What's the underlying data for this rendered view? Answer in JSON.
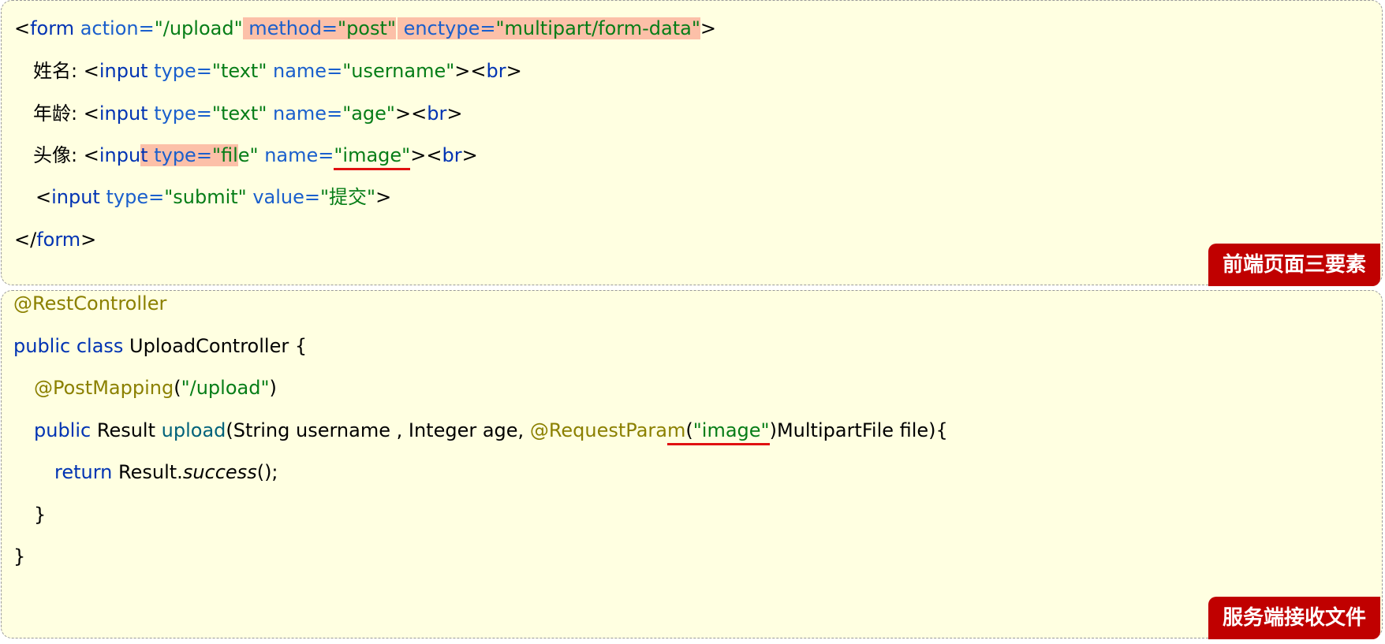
{
  "front": {
    "form_open": {
      "lt": "<",
      "tag": "form",
      "action_attr": " action=",
      "action_val": "\"/upload\"",
      "method_attr": " method=",
      "method_val": "\"post\"",
      "enctype_attr": " enctype=",
      "enctype_val": "\"multipart/form-data\"",
      "gt": ">"
    },
    "name_row": {
      "label": "姓名: ",
      "lt": "<",
      "tag": "input",
      "type_attr": " type=",
      "type_val": "\"text\"",
      "name_attr": " name=",
      "name_val": "\"username\"",
      "gt": ">",
      "br_lt": "<",
      "br": "br",
      "br_gt": ">"
    },
    "age_row": {
      "label": "年龄: ",
      "lt": "<",
      "tag": "input",
      "type_attr": " type=",
      "type_val": "\"text\"",
      "name_attr": " name=",
      "name_val": "\"age\"",
      "gt": ">",
      "br_lt": "<",
      "br": "br",
      "br_gt": ">"
    },
    "image_row": {
      "label": "头像: ",
      "lt": "<",
      "tag_a": "inpu",
      "tag_b": "t",
      "type_attr": " type=",
      "type_val_a": "\"fil",
      "type_val_b": "e\"",
      "name_attr": " name=",
      "name_val": "\"image\"",
      "gt": ">",
      "br_lt": "<",
      "br": "br",
      "br_gt": ">"
    },
    "submit_row": {
      "lt": "<",
      "tag": "input",
      "type_attr": " type=",
      "type_val": "\"submit\"",
      "value_attr": " value=",
      "value_val": "\"提交\"",
      "gt": ">"
    },
    "form_close": {
      "lt": "</",
      "tag": "form",
      "gt": ">"
    },
    "badge": "前端页面三要素"
  },
  "back": {
    "rest_annotation": "@RestController",
    "class_decl": {
      "keywords": "public class",
      "name": " UploadController {"
    },
    "post_mapping": {
      "annotation": "@PostMapping",
      "paren_open": "(",
      "value": "\"/upload\"",
      "paren_close": ")"
    },
    "method_sig": {
      "keyword": "public",
      "ret": " Result ",
      "name": "upload",
      "params_a": "(String username , Integer age, ",
      "annotation_a": "@RequestPara",
      "annotation_b": "m",
      "paren_open": "(",
      "value": "\"image\"",
      "params_b": ")MultipartFile file){"
    },
    "return_stmt": {
      "keyword": "return",
      "obj": " Result.",
      "method": "success",
      "tail": "();"
    },
    "close_method": "}",
    "close_class": "}",
    "badge": "服务端接收文件"
  },
  "colors": {
    "panel_bg": "#ffffe1",
    "highlight": "#fcc0a8",
    "underline": "#e01010",
    "badge_bg": "#c00000"
  }
}
